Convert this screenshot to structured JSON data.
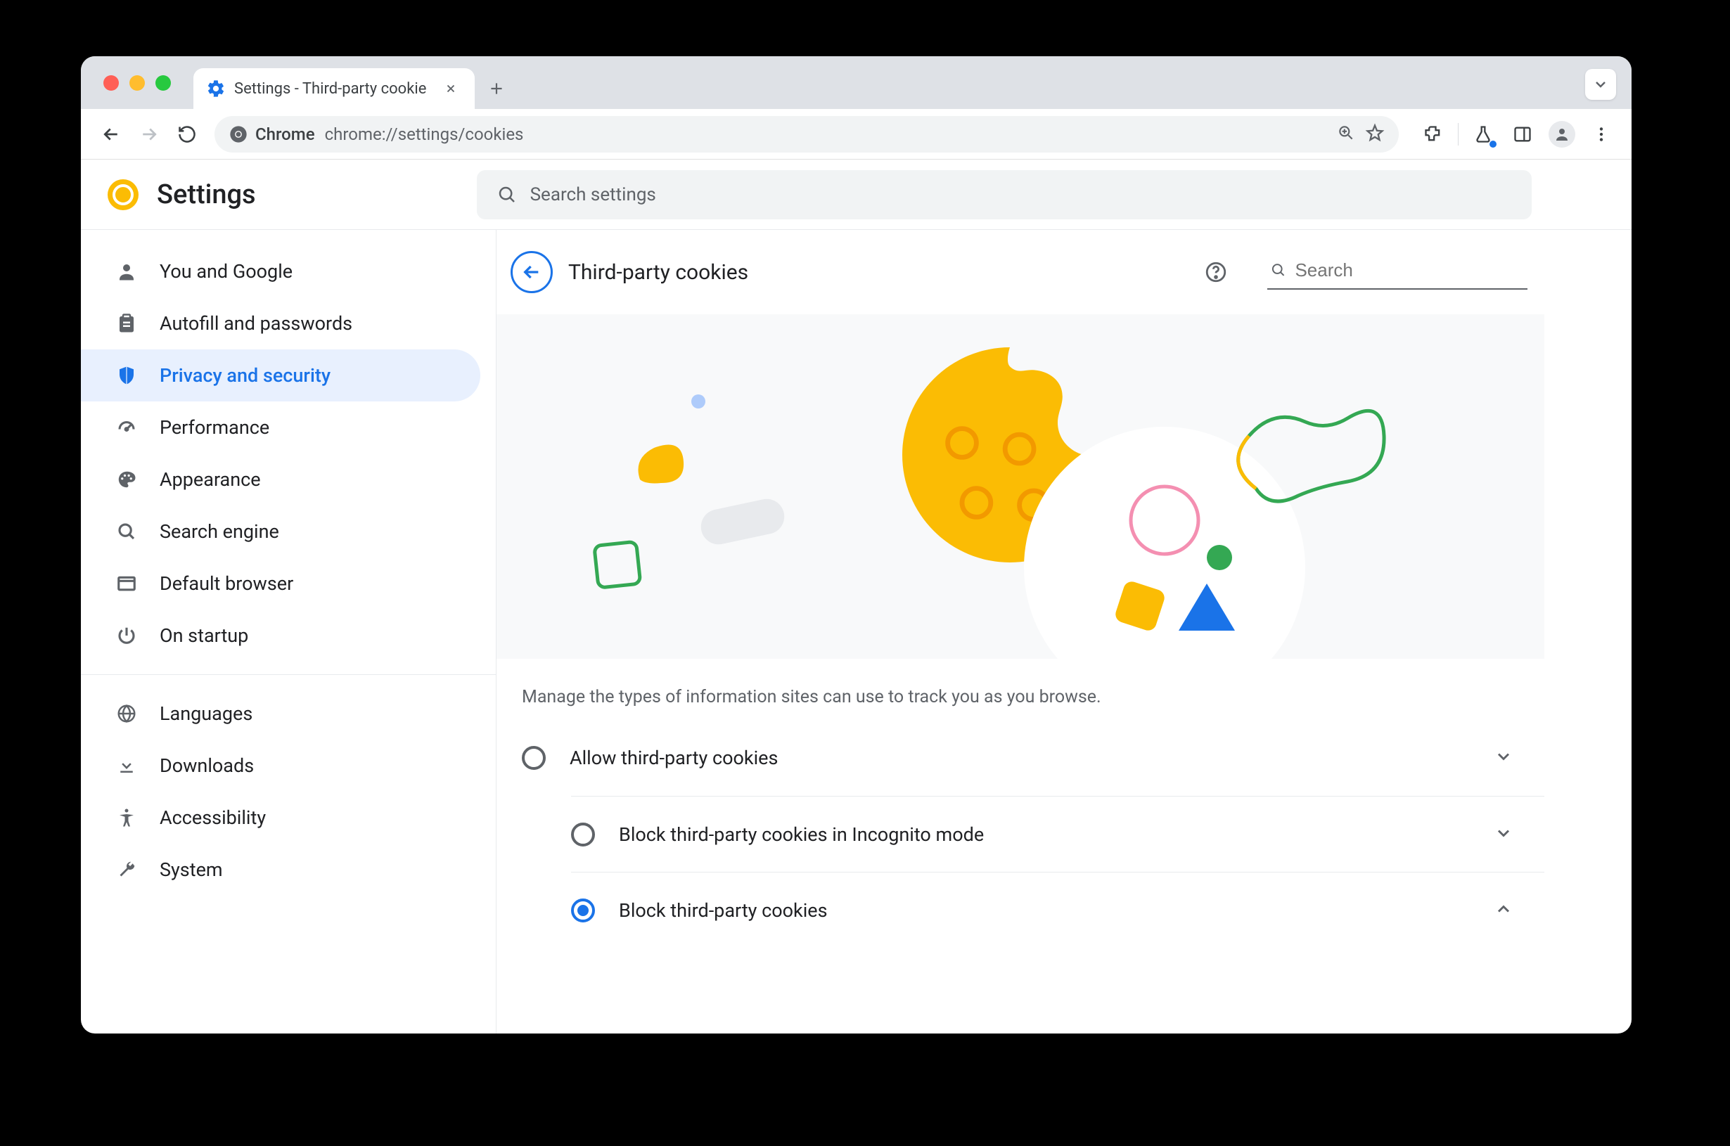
{
  "window": {
    "tab_title": "Settings - Third-party cookie",
    "url": "chrome://settings/cookies",
    "url_scheme_chip": "Chrome"
  },
  "settings": {
    "app_title": "Settings",
    "search_placeholder": "Search settings"
  },
  "sidebar": {
    "items": [
      {
        "label": "You and Google",
        "icon": "person"
      },
      {
        "label": "Autofill and passwords",
        "icon": "clipboard"
      },
      {
        "label": "Privacy and security",
        "icon": "shield",
        "active": true
      },
      {
        "label": "Performance",
        "icon": "speedometer"
      },
      {
        "label": "Appearance",
        "icon": "palette"
      },
      {
        "label": "Search engine",
        "icon": "search"
      },
      {
        "label": "Default browser",
        "icon": "browser"
      },
      {
        "label": "On startup",
        "icon": "power"
      }
    ],
    "items2": [
      {
        "label": "Languages",
        "icon": "globe"
      },
      {
        "label": "Downloads",
        "icon": "download"
      },
      {
        "label": "Accessibility",
        "icon": "accessibility"
      },
      {
        "label": "System",
        "icon": "wrench"
      }
    ]
  },
  "page": {
    "title": "Third-party cookies",
    "search_placeholder": "Search",
    "description": "Manage the types of information sites can use to track you as you browse.",
    "options": [
      {
        "label": "Allow third-party cookies",
        "checked": false,
        "expanded": false
      },
      {
        "label": "Block third-party cookies in Incognito mode",
        "checked": false,
        "expanded": false
      },
      {
        "label": "Block third-party cookies",
        "checked": true,
        "expanded": true
      }
    ]
  },
  "colors": {
    "accent": "#1a73e8",
    "yellow": "#fbbc04",
    "green": "#34a853",
    "pink": "#f06292"
  }
}
